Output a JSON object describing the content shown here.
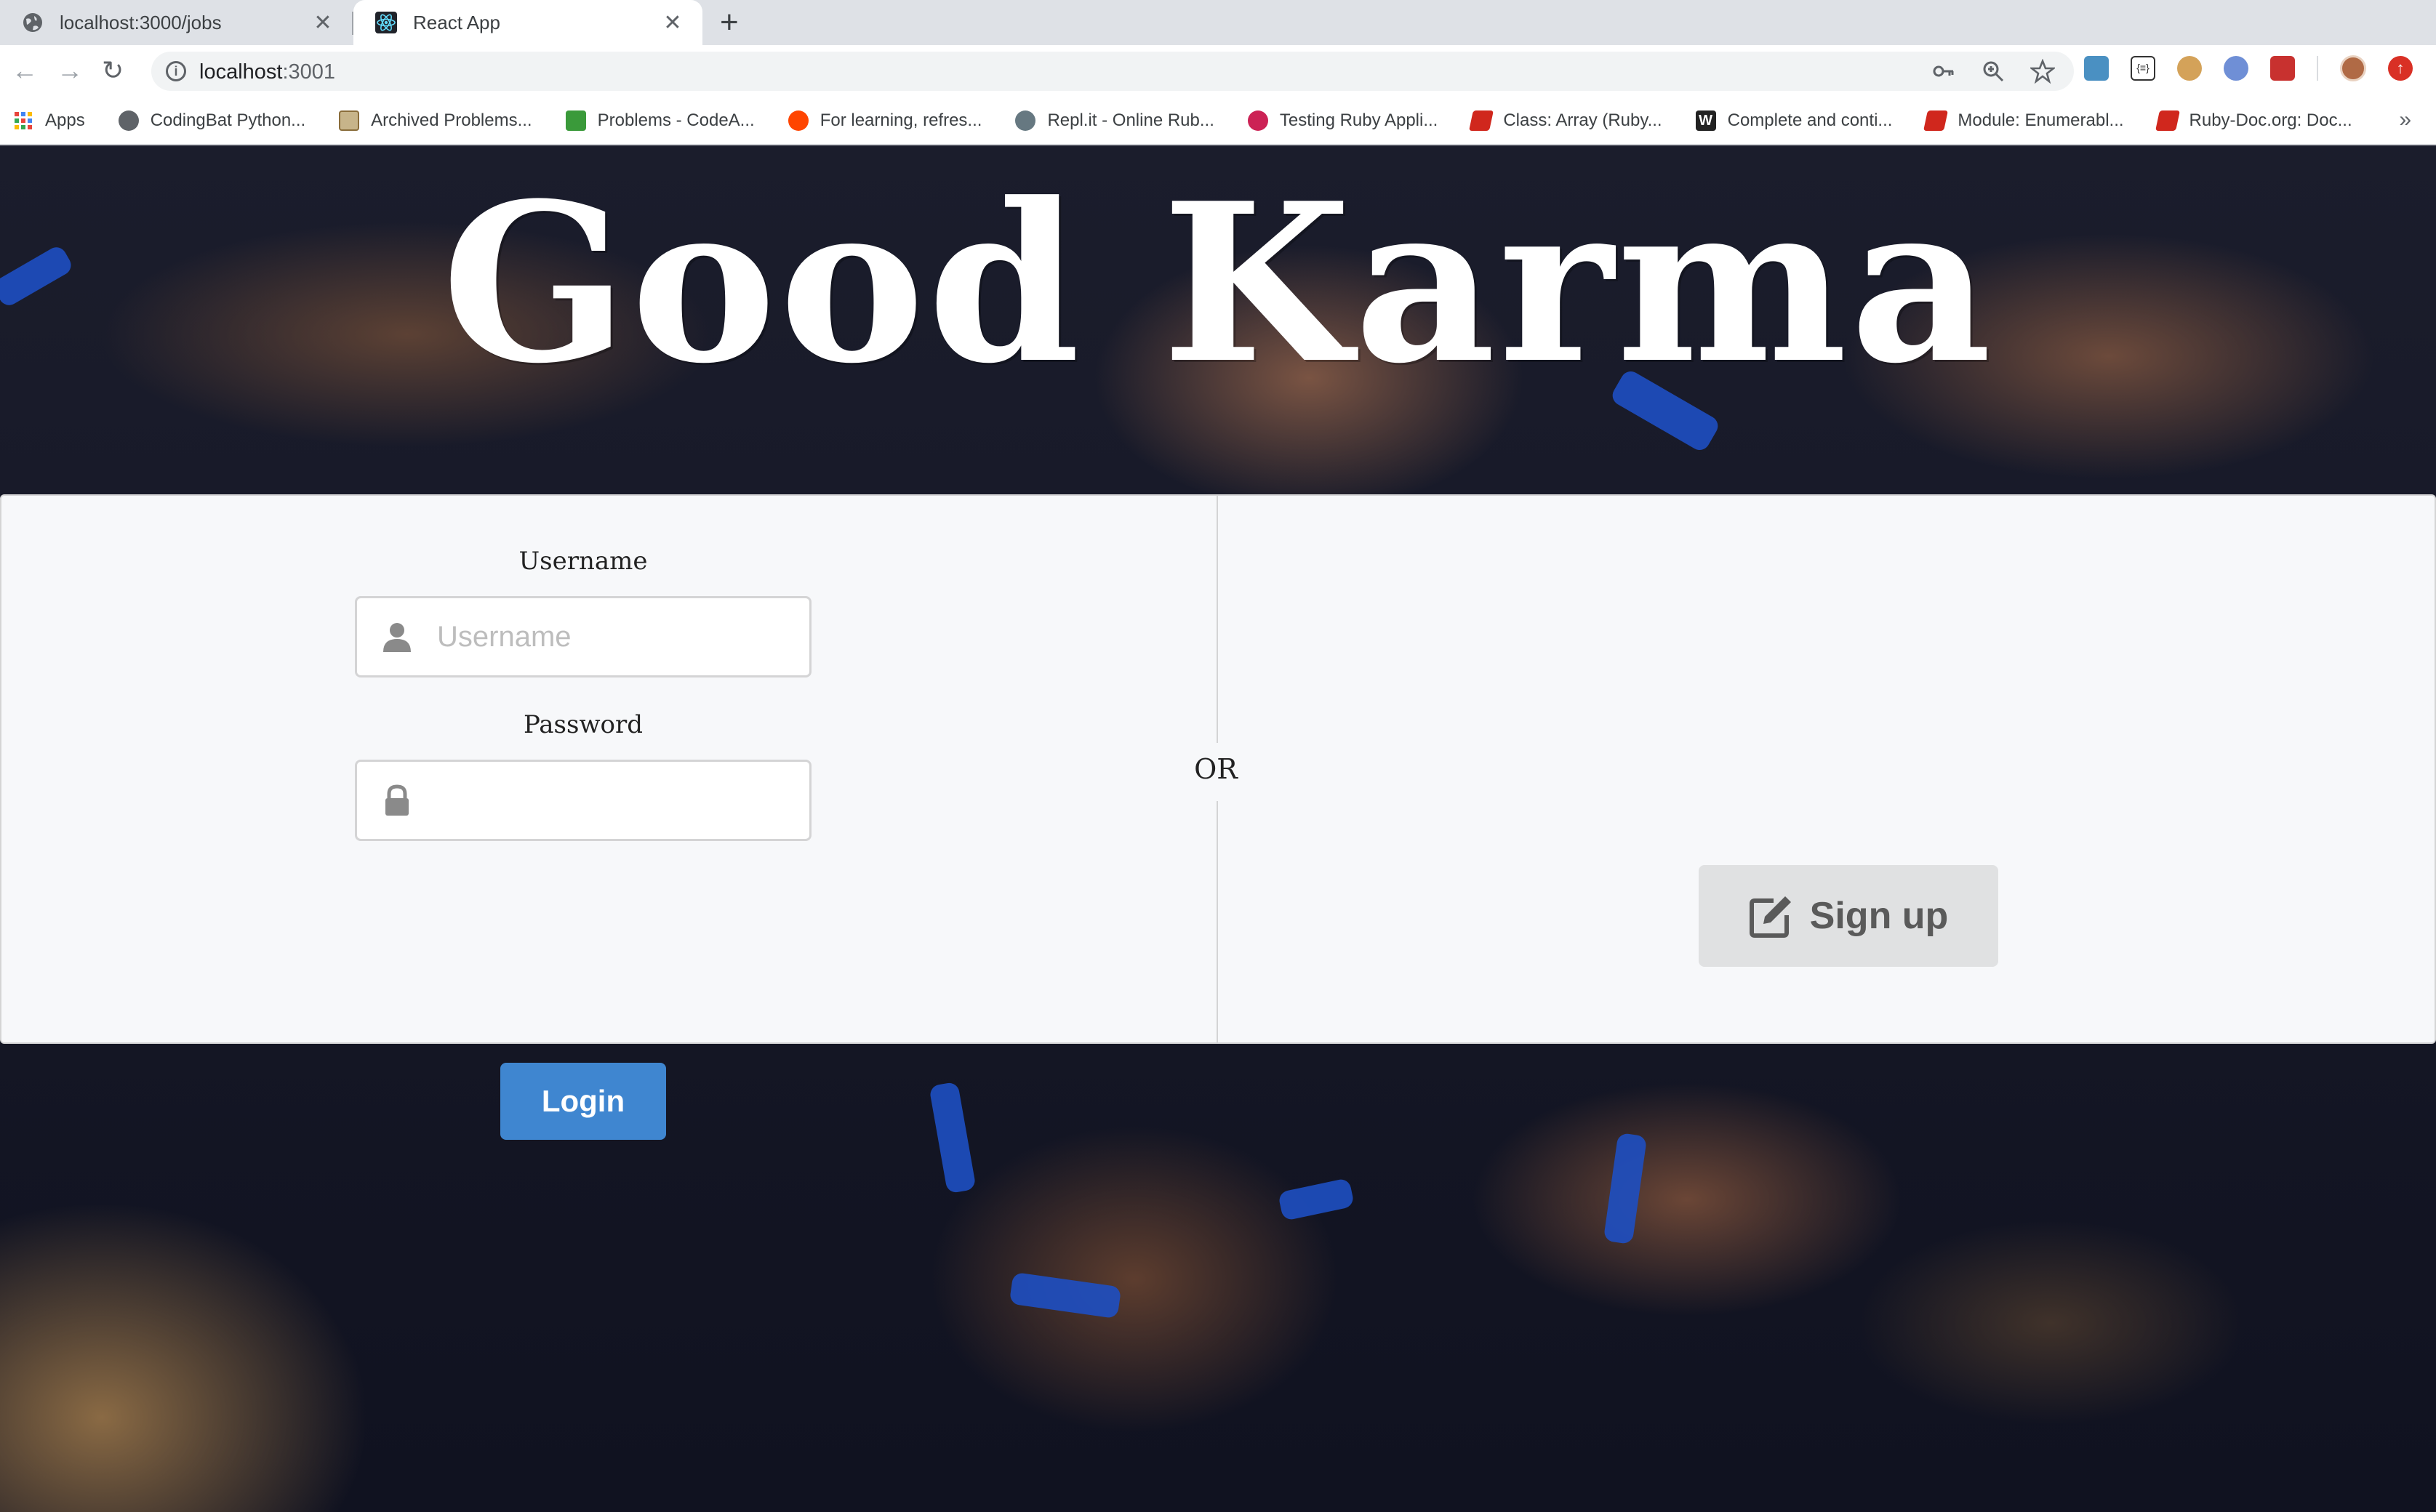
{
  "browser": {
    "tabs": [
      {
        "title": "localhost:3000/jobs",
        "active": false,
        "icon": "globe-icon"
      },
      {
        "title": "React App",
        "active": true,
        "icon": "react-icon"
      }
    ],
    "new_tab_glyph": "+",
    "close_glyph": "✕",
    "url": {
      "host": "localhost",
      "port": ":3001"
    },
    "bookmarks": [
      {
        "label": "Apps",
        "icon": "apps-grid-icon",
        "color": "#e8453c"
      },
      {
        "label": "CodingBat Python...",
        "icon": "globe-icon",
        "color": "#5f6368"
      },
      {
        "label": "Archived Problems...",
        "icon": "project-euler-icon",
        "color": "#8a6d3b"
      },
      {
        "label": "Problems - CodeA...",
        "icon": "codeabbey-icon",
        "color": "#3a9a3a"
      },
      {
        "label": "For learning, refres...",
        "icon": "reddit-icon",
        "color": "#ff4500"
      },
      {
        "label": "Repl.it - Online Rub...",
        "icon": "replit-icon",
        "color": "#667881"
      },
      {
        "label": "Testing Ruby Appli...",
        "icon": "rubyguides-icon",
        "color": "#cc2255"
      },
      {
        "label": "Class: Array (Ruby...",
        "icon": "ruby-icon",
        "color": "#d0271d"
      },
      {
        "label": "Complete and conti...",
        "icon": "w-icon",
        "color": "#222222"
      },
      {
        "label": "Module: Enumerabl...",
        "icon": "ruby-icon",
        "color": "#d0271d"
      },
      {
        "label": "Ruby-Doc.org: Doc...",
        "icon": "ruby-icon",
        "color": "#d0271d"
      }
    ],
    "more_glyph": "»"
  },
  "page": {
    "title": "Good Karma",
    "username_label": "Username",
    "username_placeholder": "Username",
    "password_label": "Password",
    "login_label": "Login",
    "or_label": "OR",
    "signup_label": "Sign up"
  },
  "colors": {
    "login_button": "#3f86d0",
    "signup_button": "#e0e1e2",
    "wristband": "#1e4fc2"
  }
}
